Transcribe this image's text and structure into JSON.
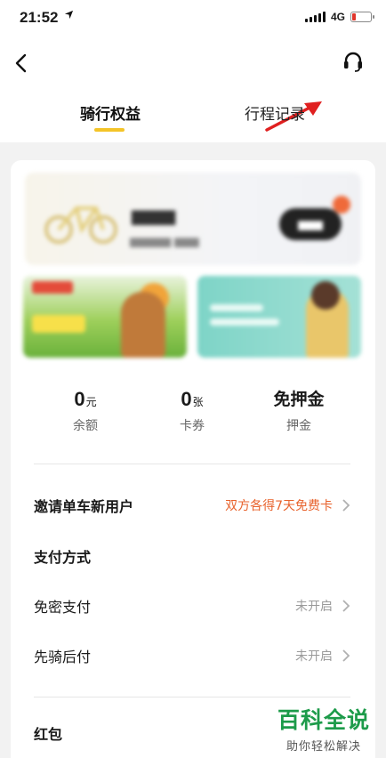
{
  "status_bar": {
    "time": "21:52",
    "location_icon": "location-arrow-icon",
    "network": "4G",
    "battery_color": "#e0352b"
  },
  "nav": {
    "back_icon": "chevron-left-icon",
    "support_icon": "headset-icon",
    "annotation_color": "#e02020"
  },
  "tabs": [
    {
      "label": "骑行权益",
      "active": true
    },
    {
      "label": "行程记录",
      "active": false
    }
  ],
  "accent_color": "#f4c428",
  "stats": [
    {
      "value": "0",
      "unit": "元",
      "label": "余额"
    },
    {
      "value": "0",
      "unit": "张",
      "label": "卡券"
    },
    {
      "value": "免押金",
      "unit": "",
      "label": "押金"
    }
  ],
  "rows": {
    "invite": {
      "label": "邀请单车新用户",
      "value": "双方各得7天免费卡",
      "value_color": "#e8632d"
    },
    "payment_header": {
      "label": "支付方式"
    },
    "password_free": {
      "label": "免密支付",
      "value": "未开启"
    },
    "ride_first": {
      "label": "先骑后付",
      "value": "未开启"
    },
    "red_packet": {
      "label": "红包"
    }
  },
  "watermark": {
    "title": "百科全说",
    "subtitle": "助你轻松解决",
    "color": "#1d9b4a"
  }
}
